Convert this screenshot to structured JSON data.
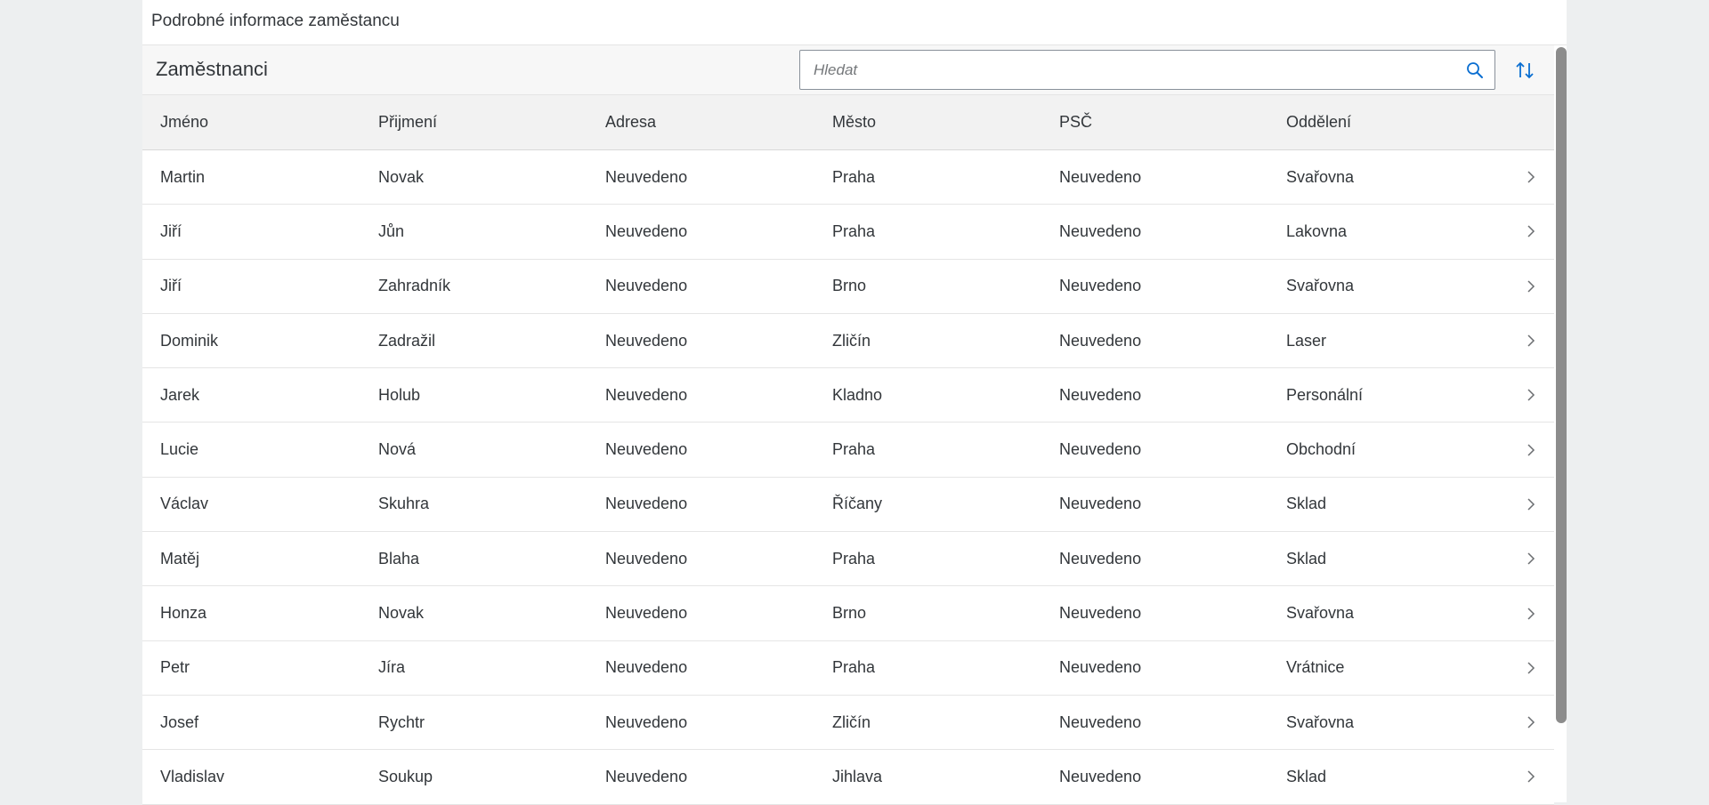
{
  "page": {
    "title": "Podrobné informace zaměstancu"
  },
  "toolbar": {
    "title": "Zaměstnanci",
    "search_placeholder": "Hledat",
    "search_value": ""
  },
  "icons": {
    "search": "search-icon",
    "sort": "sort-icon",
    "row_nav": "chevron-right-icon"
  },
  "colors": {
    "accent": "#0a6ed1",
    "header_bg": "#f2f2f2",
    "page_bg": "#edeff0"
  },
  "table": {
    "columns": [
      "Jméno",
      "Přijmení",
      "Adresa",
      "Město",
      "PSČ",
      "Oddělení"
    ],
    "rows": [
      [
        "Martin",
        "Novak",
        "Neuvedeno",
        "Praha",
        "Neuvedeno",
        "Svařovna"
      ],
      [
        "Jiří",
        "Jůn",
        "Neuvedeno",
        "Praha",
        "Neuvedeno",
        "Lakovna"
      ],
      [
        "Jiří",
        "Zahradník",
        "Neuvedeno",
        "Brno",
        "Neuvedeno",
        "Svařovna"
      ],
      [
        "Dominik",
        "Zadražil",
        "Neuvedeno",
        "Zličín",
        "Neuvedeno",
        "Laser"
      ],
      [
        "Jarek",
        "Holub",
        "Neuvedeno",
        "Kladno",
        "Neuvedeno",
        "Personální"
      ],
      [
        "Lucie",
        "Nová",
        "Neuvedeno",
        "Praha",
        "Neuvedeno",
        "Obchodní"
      ],
      [
        "Václav",
        "Skuhra",
        "Neuvedeno",
        "Říčany",
        "Neuvedeno",
        "Sklad"
      ],
      [
        "Matěj",
        "Blaha",
        "Neuvedeno",
        "Praha",
        "Neuvedeno",
        "Sklad"
      ],
      [
        "Honza",
        "Novak",
        "Neuvedeno",
        "Brno",
        "Neuvedeno",
        "Svařovna"
      ],
      [
        "Petr",
        "Jíra",
        "Neuvedeno",
        "Praha",
        "Neuvedeno",
        "Vrátnice"
      ],
      [
        "Josef",
        "Rychtr",
        "Neuvedeno",
        "Zličín",
        "Neuvedeno",
        "Svařovna"
      ],
      [
        "Vladislav",
        "Soukup",
        "Neuvedeno",
        "Jihlava",
        "Neuvedeno",
        "Sklad"
      ]
    ]
  }
}
